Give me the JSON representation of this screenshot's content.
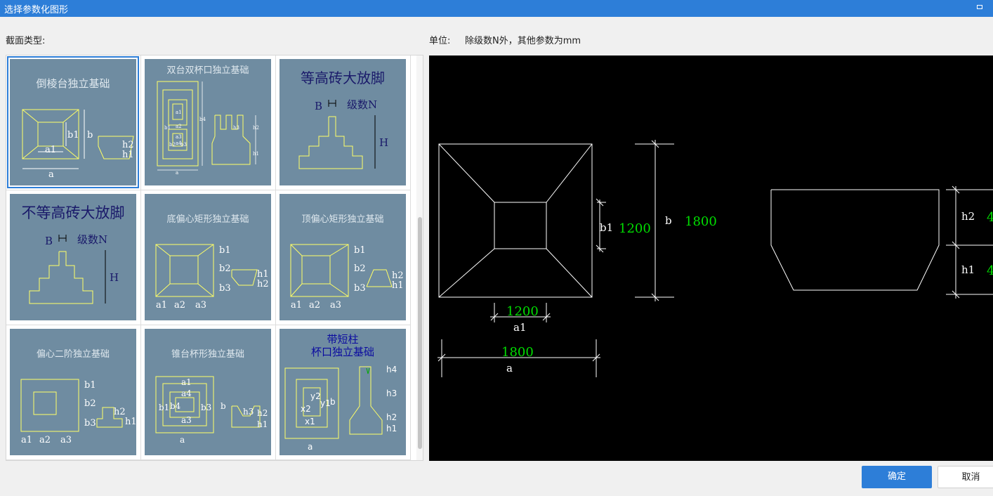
{
  "window": {
    "title": "选择参数化图形"
  },
  "labels": {
    "section_type": "截面类型:",
    "unit_label": "单位:",
    "unit_desc": "除级数N外，其他参数为mm"
  },
  "thumbnails": [
    {
      "title": "倒棱台独立基础",
      "dims": [
        "a1",
        "b1",
        "b",
        "h2",
        "h1",
        "a"
      ]
    },
    {
      "title": "双台双杯口独立基础",
      "dims": [
        "a1",
        "a2",
        "a3",
        "a4",
        "b1",
        "b2",
        "b3",
        "b4",
        "h1",
        "h2",
        "h3",
        "a"
      ]
    },
    {
      "title": "等高砖大放脚",
      "dims": [
        "B",
        "级数N",
        "H"
      ]
    },
    {
      "title": "不等高砖大放脚",
      "dims": [
        "B",
        "级数N",
        "H"
      ]
    },
    {
      "title": "底偏心矩形独立基础",
      "dims": [
        "b1",
        "b2",
        "b3",
        "h1",
        "h2",
        "a1",
        "a2",
        "a3"
      ]
    },
    {
      "title": "顶偏心矩形独立基础",
      "dims": [
        "b1",
        "b2",
        "b3",
        "h2",
        "h1",
        "a1",
        "a2",
        "a3"
      ]
    },
    {
      "title": "偏心二阶独立基础",
      "dims": [
        "b1",
        "b2",
        "b3",
        "h2",
        "h1",
        "a1",
        "a2",
        "a3"
      ]
    },
    {
      "title": "锥台杯形独立基础",
      "dims": [
        "a1",
        "a4",
        "b1",
        "b4",
        "b3",
        "a3",
        "b",
        "h3",
        "h2",
        "h1",
        "a"
      ]
    },
    {
      "title1": "带短柱",
      "title2": "杯口独立基础",
      "dims": [
        "h4",
        "h3",
        "h2",
        "h1",
        "y2",
        "y1",
        "x2",
        "x1",
        "b",
        "a"
      ]
    }
  ],
  "preview": {
    "b1_label": "b1",
    "b1_value": "1200",
    "b_label": "b",
    "b_value": "1800",
    "a1_label": "a1",
    "a1_value": "1200",
    "a_label": "a",
    "a_value": "1800",
    "h2_label": "h2",
    "h2_value": "4",
    "h1_label": "h1",
    "h1_value": "4"
  },
  "buttons": {
    "ok": "确定",
    "cancel": "取消"
  },
  "colors": {
    "accent": "#2d7ed8",
    "thumb_bg": "#6f8ca1",
    "drawing_line": "#ffff66",
    "dim_value": "#00dd00"
  }
}
